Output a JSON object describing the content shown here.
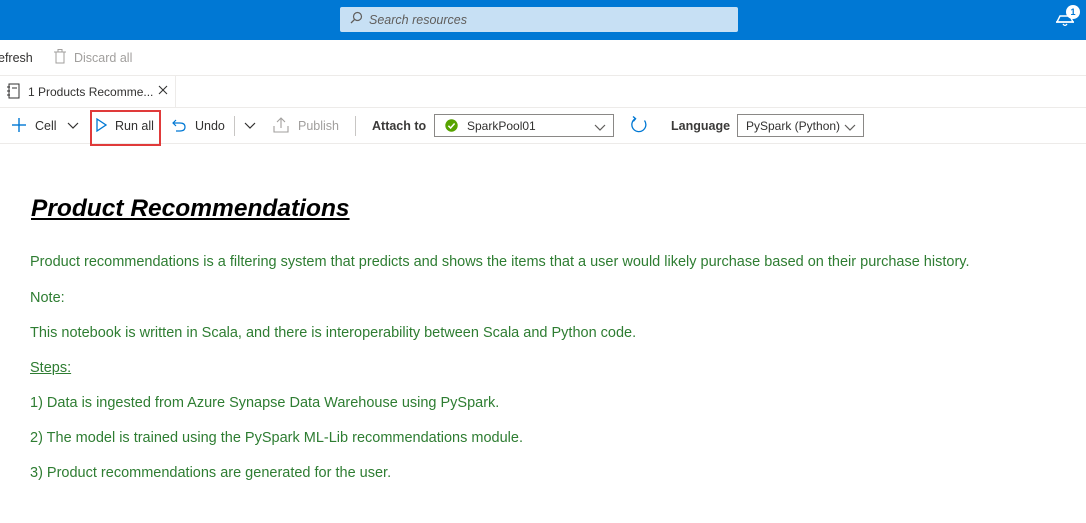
{
  "header": {
    "search_placeholder": "Search resources",
    "notification_count": "1"
  },
  "command_bar": {
    "refresh_label": "efresh",
    "discard_label": "Discard all"
  },
  "tab": {
    "title": "1 Products Recomme..."
  },
  "toolbar": {
    "cell_label": "Cell",
    "run_all_label": "Run all",
    "undo_label": "Undo",
    "publish_label": "Publish",
    "attach_to_label": "Attach to",
    "pool_value": "SparkPool01",
    "language_label": "Language",
    "language_value": "PySpark (Python)"
  },
  "notebook": {
    "title": "Product Recommendations",
    "description": "Product recommendations is a filtering system that predicts and shows the items that a user would likely purchase based on their purchase history.",
    "note_label": "Note:",
    "note_text": "This notebook is written in Scala, and there is interoperability between Scala and Python code.",
    "steps_label": "Steps:",
    "steps": [
      "1) Data is ingested from Azure Synapse Data Warehouse using PySpark.",
      "2) The model is trained using the PySpark ML-Lib recommendations module.",
      "3) Product recommendations are generated for the user."
    ]
  },
  "colors": {
    "brand_blue": "#0078d4",
    "markdown_green": "#2e7d32",
    "highlight_red": "#e03a3a",
    "status_green": "#57a300"
  },
  "icons": [
    "search-icon",
    "notification-icon",
    "trash-icon",
    "notebook-icon",
    "close-icon",
    "plus-icon",
    "chevron-down-icon",
    "play-icon",
    "undo-icon",
    "publish-icon",
    "check-circle-icon",
    "refresh-icon"
  ]
}
